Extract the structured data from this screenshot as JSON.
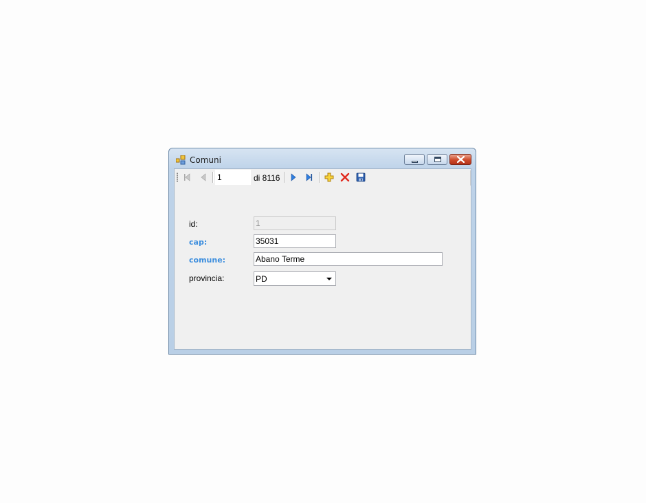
{
  "window": {
    "title": "Comuni",
    "icon": "app-form-icon"
  },
  "navigator": {
    "position": "1",
    "count_label": "di 8116",
    "buttons": [
      "move-first-icon",
      "move-previous-icon",
      "move-next-icon",
      "move-last-icon",
      "add-new-icon",
      "delete-icon",
      "save-icon"
    ]
  },
  "form": {
    "id_label": "id:",
    "id_value": "1",
    "cap_label": "cap:",
    "cap_value": "35031",
    "comune_label": "comune:",
    "comune_value": "Abano Terme",
    "provincia_label": "provincia:",
    "provincia_value": "PD"
  },
  "colors": {
    "required_label": "#3d8ede",
    "client_background": "#f0f0f0",
    "close_button": "#cd4a2a"
  }
}
